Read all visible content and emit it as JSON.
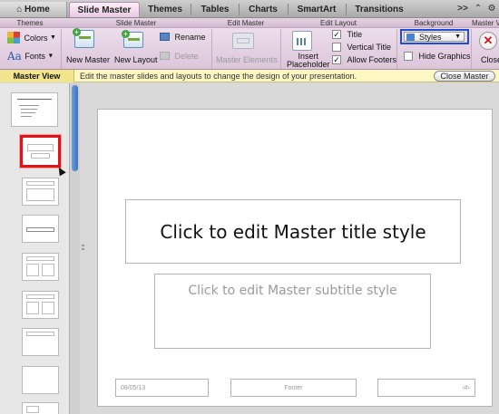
{
  "tabs": [
    {
      "label": "Home",
      "icon": "home-icon"
    },
    {
      "label": "Slide Master",
      "active": true
    },
    {
      "label": "Themes"
    },
    {
      "label": "Tables"
    },
    {
      "label": "Charts"
    },
    {
      "label": "SmartArt"
    },
    {
      "label": "Transitions"
    }
  ],
  "tab_overflow_glyph": ">>",
  "ribbon": {
    "groups": {
      "themes": "Themes",
      "slide_master": "Slide Master",
      "edit_master": "Edit Master",
      "edit_layout": "Edit Layout",
      "background": "Background",
      "master_view": "Master Vi"
    },
    "colors_label": "Colors",
    "fonts_label": "Fonts",
    "fonts_glyph": "Aa",
    "new_master_label": "New Master",
    "new_layout_label": "New Layout",
    "rename_label": "Rename",
    "delete_label": "Delete",
    "master_elements_label": "Master Elements",
    "insert_placeholder_label": "Insert",
    "insert_placeholder_label2": "Placeholder",
    "title_check": {
      "label": "Title",
      "checked": true
    },
    "vertical_title_check": {
      "label": "Vertical Title",
      "checked": false
    },
    "allow_footers_check": {
      "label": "Allow Footers",
      "checked": true
    },
    "styles_label": "Styles",
    "hide_graphics_check": {
      "label": "Hide Graphics",
      "checked": false
    },
    "close_label": "Close"
  },
  "infobar": {
    "mode_label": "Master View",
    "message": "Edit the master slides and layouts to change the design of your presentation.",
    "close_button": "Close Master"
  },
  "slide": {
    "title": "Click to edit Master title style",
    "subtitle": "Click to edit Master subtitle style",
    "date": "08/05/13",
    "footer": "Footer",
    "slide_number": "‹#›"
  },
  "colors": {
    "accent_tab": "#e8c8e4",
    "ribbon": "#e9d8e7",
    "infobar": "#fdf7c2",
    "selection": "#e0141b",
    "highlight_box": "#1f4fd6"
  }
}
